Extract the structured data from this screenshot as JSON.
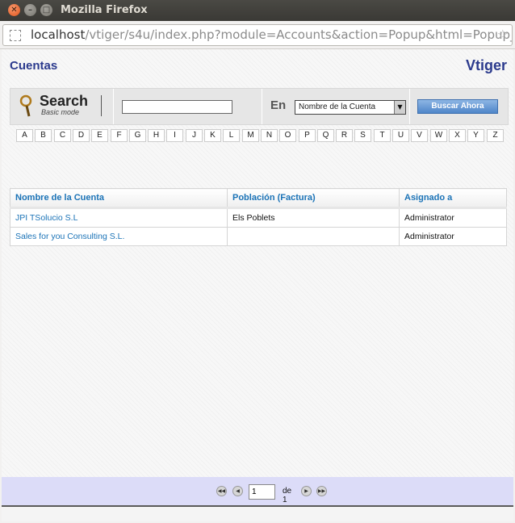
{
  "window": {
    "title": "Mozilla Firefox",
    "url_host": "localhost",
    "url_rest": "/vtiger/s4u/index.php?module=Accounts&action=Popup&html=Popup_picke"
  },
  "header": {
    "module_title": "Cuentas",
    "brand": "Vtiger"
  },
  "search": {
    "title": "Search",
    "mode": "Basic mode",
    "input_value": "",
    "in_label": "En",
    "field_selected": "Nombre de la Cuenta",
    "button_label": "Buscar Ahora"
  },
  "alphabet": [
    "A",
    "B",
    "C",
    "D",
    "E",
    "F",
    "G",
    "H",
    "I",
    "J",
    "K",
    "L",
    "M",
    "N",
    "O",
    "P",
    "Q",
    "R",
    "S",
    "T",
    "U",
    "V",
    "W",
    "X",
    "Y",
    "Z"
  ],
  "table": {
    "columns": [
      "Nombre de la Cuenta",
      "Población (Factura)",
      "Asignado a"
    ],
    "rows": [
      {
        "name": "JPI TSolucio S.L",
        "city": "Els Poblets",
        "assigned": "Administrator"
      },
      {
        "name": "Sales for you Consulting S.L.",
        "city": "",
        "assigned": "Administrator"
      }
    ]
  },
  "pagination": {
    "current_page": "1",
    "of_label": "de 1"
  },
  "icons": {
    "close": "close-icon",
    "minimize": "minimize-icon",
    "maximize": "maximize-icon",
    "bookmark": "star-icon",
    "search": "magnifier-icon"
  }
}
